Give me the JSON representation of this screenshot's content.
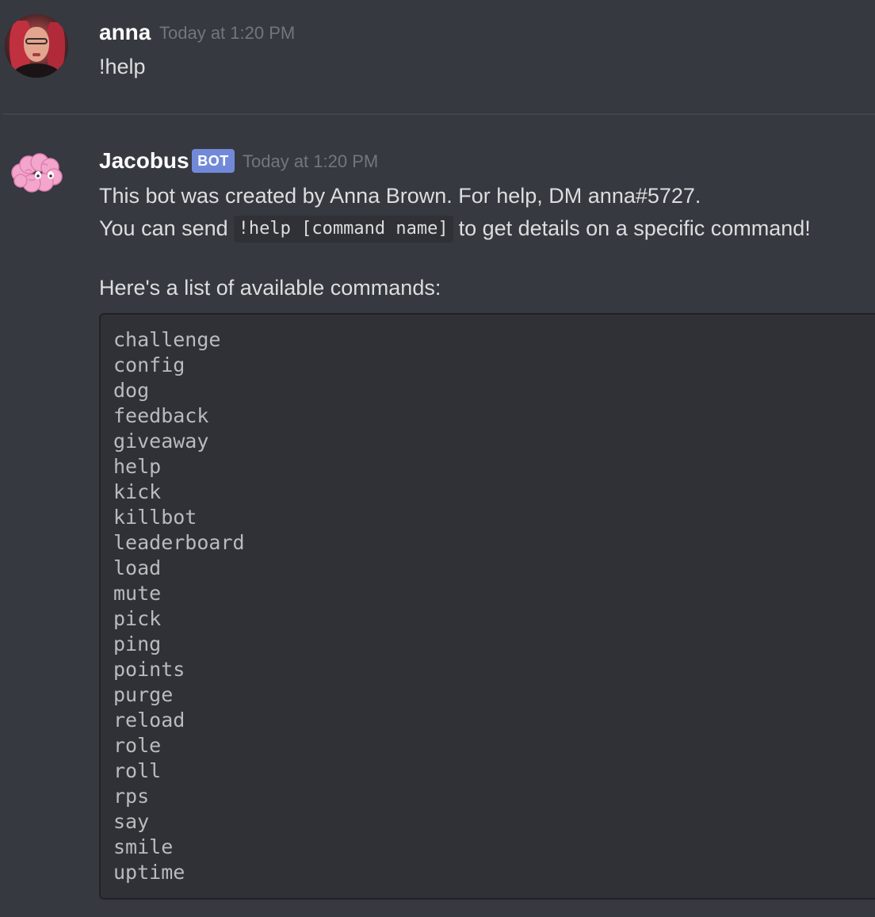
{
  "messages": [
    {
      "author": "anna",
      "timestamp": "Today at 1:20 PM",
      "content": "!help"
    },
    {
      "author": "Jacobus",
      "badge": "BOT",
      "timestamp": "Today at 1:20 PM",
      "line1": "This bot was created by Anna Brown. For help, DM anna#5727.",
      "line2_before": "You can send",
      "line2_code": "!help [command name]",
      "line2_after": "to get details on a specific command!",
      "line3": "Here's a list of available commands:",
      "commands": [
        "challenge",
        "config",
        "dog",
        "feedback",
        "giveaway",
        "help",
        "kick",
        "killbot",
        "leaderboard",
        "load",
        "mute",
        "pick",
        "ping",
        "points",
        "purge",
        "reload",
        "role",
        "roll",
        "rps",
        "say",
        "smile",
        "uptime"
      ]
    }
  ],
  "colors": {
    "background": "#36393f",
    "username": "#ffffff",
    "timestamp": "#72767d",
    "text": "#dcddde",
    "bot_badge": "#7289da",
    "code_background": "#2f3136",
    "code_text": "#b9bbbe"
  },
  "icons": {
    "user_avatar": "user-avatar-photo",
    "bot_avatar": "pink-brain-avatar"
  }
}
